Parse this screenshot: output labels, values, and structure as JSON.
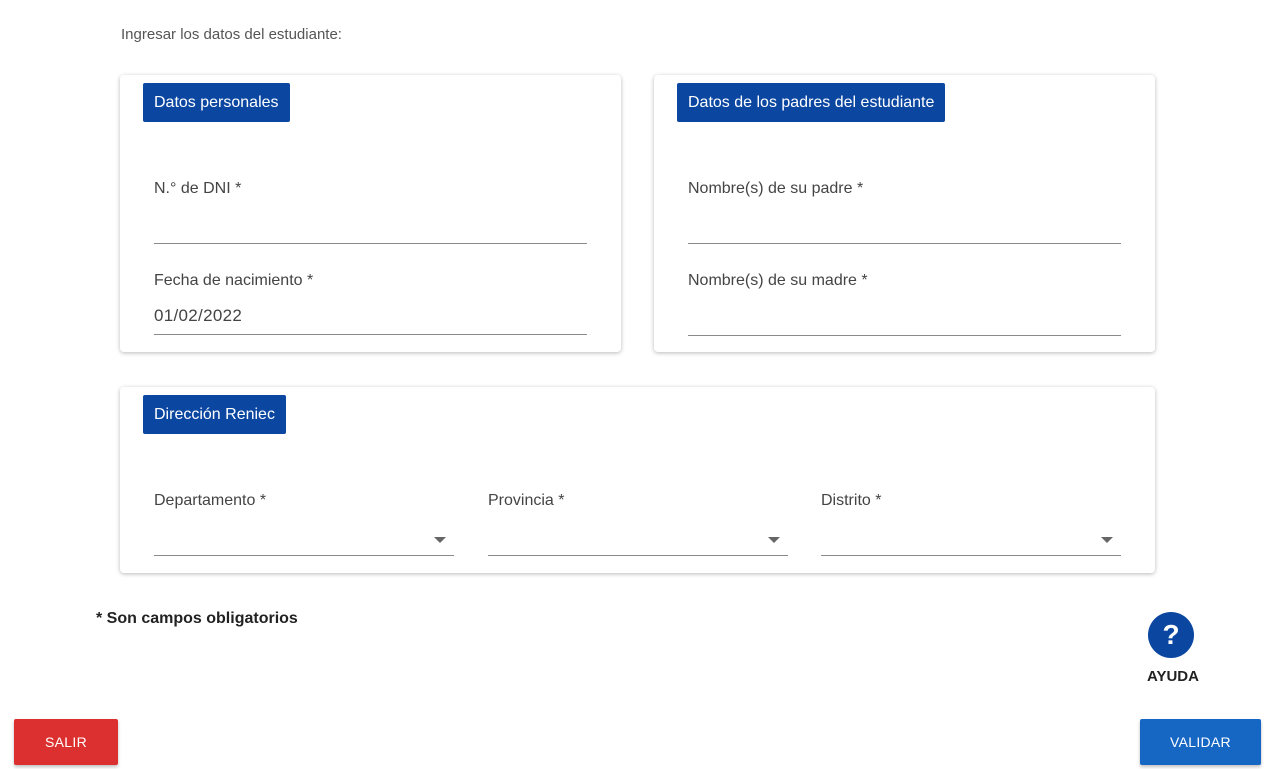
{
  "intro_text": "Ingresar los datos del estudiante:",
  "personal": {
    "header": "Datos personales",
    "dni_label": "N.° de DNI *",
    "dni_value": "",
    "birth_label": "Fecha de nacimiento *",
    "birth_value": "01/02/2022"
  },
  "parents": {
    "header": "Datos de los padres del estudiante",
    "father_label": "Nombre(s) de su padre *",
    "father_value": "",
    "mother_label": "Nombre(s) de su madre *",
    "mother_value": ""
  },
  "address": {
    "header": "Dirección Reniec",
    "department_label": "Departamento *",
    "department_value": "",
    "province_label": "Provincia *",
    "province_value": "",
    "district_label": "Distrito *",
    "district_value": ""
  },
  "required_note": "* Son campos obligatorios",
  "help": {
    "icon": "question-mark-icon",
    "glyph": "?",
    "label": "AYUDA"
  },
  "buttons": {
    "exit": "SALIR",
    "validate": "VALIDAR"
  },
  "colors": {
    "header_bg": "#0b47a1",
    "exit_bg": "#dc3030",
    "validate_bg": "#1666c4"
  }
}
